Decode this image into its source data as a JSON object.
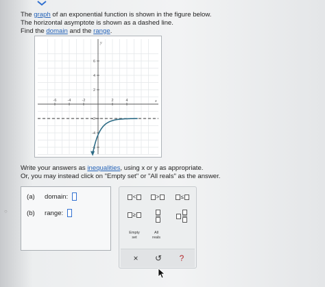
{
  "prompt": {
    "line1_pre": "The ",
    "line1_link": "graph",
    "line1_post": " of an exponential function is shown in the figure below.",
    "line2": "The horizontal asymptote is shown as a dashed line.",
    "line3_pre": "Find the ",
    "line3_link1": "domain",
    "line3_mid": " and the ",
    "line3_link2": "range",
    "line3_post": "."
  },
  "graph": {
    "x_axis_label": "x",
    "y_axis_label": "y",
    "x_tick_labels": [
      "-6",
      "-4",
      "-2",
      "2",
      "4"
    ],
    "y_tick_labels": [
      "6",
      "4",
      "2",
      "-2",
      "-4",
      "-6"
    ],
    "x_range": [
      -8,
      8
    ],
    "y_range": [
      -8,
      8
    ],
    "asymptote_y": -2,
    "curve_color": "#2e6c86",
    "asymptote_color": "#333333",
    "grid": true
  },
  "instructions": {
    "line1_pre": "Write your answers as ",
    "line1_link": "inequalities",
    "line1_post": ", using x or y as appropriate.",
    "line2": "Or, you may instead click on \"Empty set\" or \"All reals\" as the answer."
  },
  "answers": {
    "a_part": "(a)",
    "a_label": "domain:",
    "b_part": "(b)",
    "b_label": "range:"
  },
  "palette": {
    "lt": "<",
    "gt": ">",
    "le": "≤",
    "ge": "≥",
    "empty_set_l1": "Empty",
    "empty_set_l2": "set",
    "all_reals_l1": "All",
    "all_reals_l2": "reals",
    "clear": "×",
    "undo": "↺",
    "help": "?"
  },
  "colors": {
    "link": "#2563b8",
    "input_border": "#2f6fd0",
    "help": "#b3262a"
  }
}
